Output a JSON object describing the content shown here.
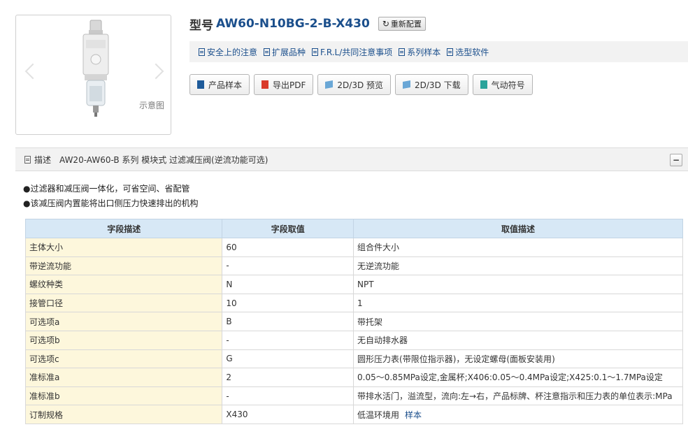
{
  "image": {
    "caption": "示意图"
  },
  "header": {
    "model_label": "型号",
    "model": "AW60-N10BG-2-B-X430",
    "reconfigure_label": "重新配置"
  },
  "doc_links": [
    "安全上的注意",
    "扩展品种",
    "F.R.L/共同注意事项",
    "系列样本",
    "选型软件"
  ],
  "buttons": [
    {
      "label": "产品样本",
      "icon": "document-icon"
    },
    {
      "label": "导出PDF",
      "icon": "pdf-icon"
    },
    {
      "label": "2D/3D 预览",
      "icon": "cube-icon"
    },
    {
      "label": "2D/3D 下载",
      "icon": "cube-icon"
    },
    {
      "label": "气动符号",
      "icon": "symbol-icon"
    }
  ],
  "description": {
    "label": "描述",
    "text": "AW20-AW60-B 系列 模块式 过滤减压阀(逆流功能可选)",
    "collapse_symbol": "−",
    "bullets": [
      "●过滤器和减压阀一体化，可省空间、省配管",
      "●该减压阀内置能将出口侧压力快速排出的机构"
    ]
  },
  "spec_table": {
    "headers": [
      "字段描述",
      "字段取值",
      "取值描述"
    ],
    "rows": [
      [
        "主体大小",
        "60",
        "组合件大小"
      ],
      [
        "带逆流功能",
        "-",
        "无逆流功能"
      ],
      [
        "螺纹种类",
        "N",
        "NPT"
      ],
      [
        "接管口径",
        "10",
        "1"
      ],
      [
        "可选项a",
        "B",
        "带托架"
      ],
      [
        "可选项b",
        "-",
        "无自动排水器"
      ],
      [
        "可选项c",
        "G",
        "圆形压力表(带限位指示器)，无设定螺母(面板安装用)"
      ],
      [
        "准标准a",
        "2",
        "0.05～0.85MPa设定,金属杯;X406:0.05～0.4MPa设定;X425:0.1～1.7MPa设定"
      ],
      [
        "准标准b",
        "-",
        "带排水活门，溢流型，流向:左→右，产品标牌、杯注意指示和压力表的单位表示:MPa"
      ],
      [
        "订制规格",
        "X430",
        "低温环境用"
      ]
    ],
    "sample_link": "样本"
  },
  "colors": {
    "accent": "#1b4f8c",
    "header_bg": "#d7e8f6",
    "field_bg": "#fdf7dc"
  }
}
